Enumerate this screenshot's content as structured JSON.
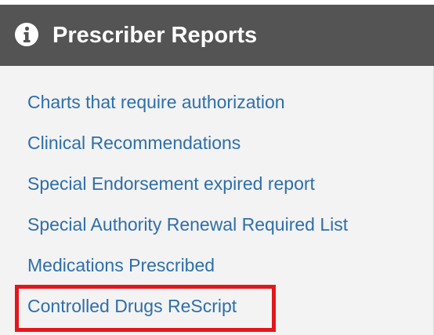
{
  "header": {
    "icon": "info-circle-icon",
    "title": "Prescriber Reports"
  },
  "links": [
    {
      "label": "Charts that require authorization"
    },
    {
      "label": "Clinical Recommendations"
    },
    {
      "label": "Special Endorsement expired report"
    },
    {
      "label": "Special Authority Renewal Required List"
    },
    {
      "label": "Medications Prescribed"
    },
    {
      "label": "Controlled Drugs ReScript"
    }
  ],
  "colors": {
    "header_bg": "#545454",
    "panel_bg": "#f3f3f3",
    "link": "#2e6faa",
    "highlight": "#e3161b"
  }
}
